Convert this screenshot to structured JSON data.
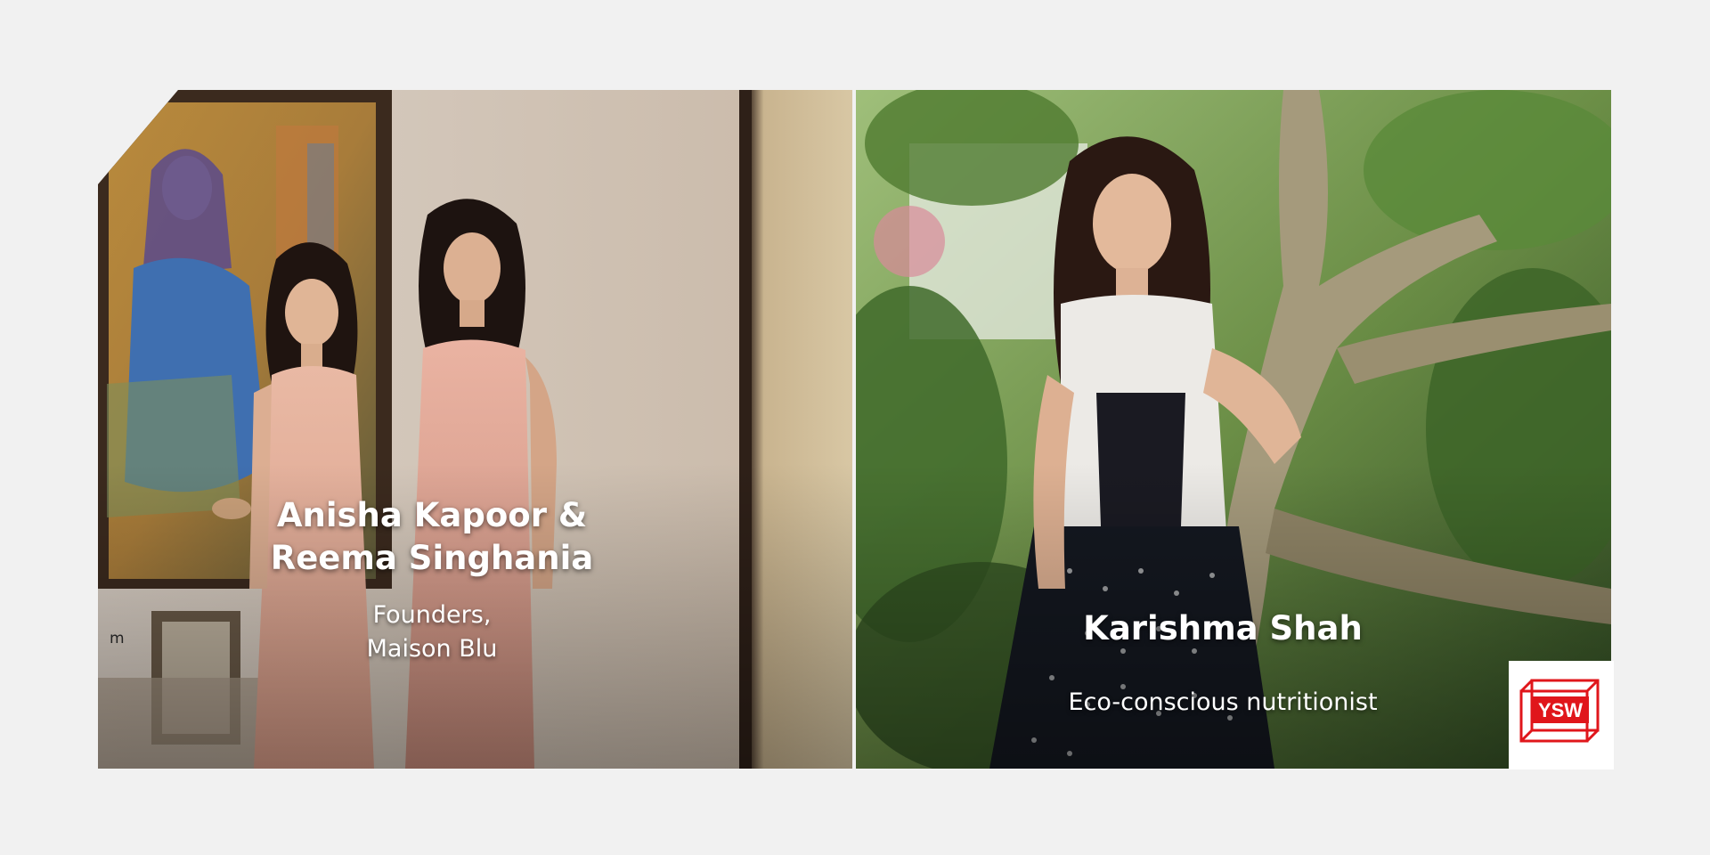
{
  "left_panel": {
    "name_line1": "Anisha Kapoor &",
    "name_line2": "Reema Singhania",
    "role_line1": "Founders,",
    "role_line2": "Maison Blu",
    "edge_label": "m"
  },
  "right_panel": {
    "name": "Karishma Shah",
    "role": "Eco-conscious nutritionist"
  },
  "logo": {
    "text": "YSW",
    "color": "#e0161b"
  },
  "colors": {
    "background": "#f1f1f1",
    "caption_text": "#ffffff"
  }
}
